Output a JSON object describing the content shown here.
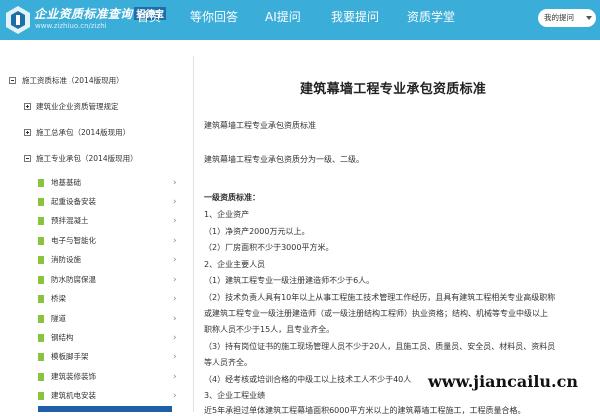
{
  "header": {
    "logo": {
      "title": "企业资质标准查询",
      "tag": "招德宝",
      "url_text": "www.zizhiuo.cn/zizhi"
    },
    "nav": [
      "首页",
      "等你回答",
      "AI提问",
      "我要提问",
      "资质学堂"
    ],
    "dropdown": {
      "label": "我的提问"
    },
    "colors": {
      "bar": "#3aaed8",
      "accent": "#1f5fa8",
      "leaf_icon": "#8ac43f"
    }
  },
  "sidebar": {
    "root": "施工资质标准（2014版现用）",
    "groups": [
      "建筑业企业资质管理规定",
      "施工总承包（2014版现用）",
      "施工专业承包（2014版现用）"
    ],
    "items": [
      "地基基础",
      "起重设备安装",
      "预拌混凝土",
      "电子与智能化",
      "消防设施",
      "防水防腐保温",
      "桥梁",
      "隧道",
      "钢结构",
      "模板脚手架",
      "建筑装修装饰",
      "建筑机电安装"
    ]
  },
  "article": {
    "title": "建筑幕墙工程专业承包资质标准",
    "intro": "建筑幕墙工程专业承包资质标准",
    "grade_note": "建筑幕墙工程专业承包资质分为一级、二级。",
    "level_heading": "一级资质标准：",
    "lines": [
      "1、企业资产",
      "（1）净资产2000万元以上。",
      "（2）厂房面积不少于3000平方米。",
      "2、企业主要人员",
      "（1）建筑工程专业一级注册建造师不少于6人。",
      "（2）技术负责人具有10年以上从事工程施工技术管理工作经历，且具有建筑工程相关专业高级职称",
      "或建筑工程专业一级注册建造师（或一级注册结构工程师）执业资格；结构、机械等专业中级以上",
      "职称人员不少于15人，且专业齐全。",
      "（3）持有岗位证书的施工现场管理人员不少于20人，且施工员、质量员、安全员、材料员、资料员",
      "等人员齐全。",
      "（4）经考核或培训合格的中级工以上技术工人不少于40人",
      "3、企业工程业绩",
      "近5年承担过单体建筑工程幕墙面积6000平方米以上的建筑幕墙工程施工，工程质量合格。"
    ]
  },
  "watermark": "www.jiancailu.cn"
}
